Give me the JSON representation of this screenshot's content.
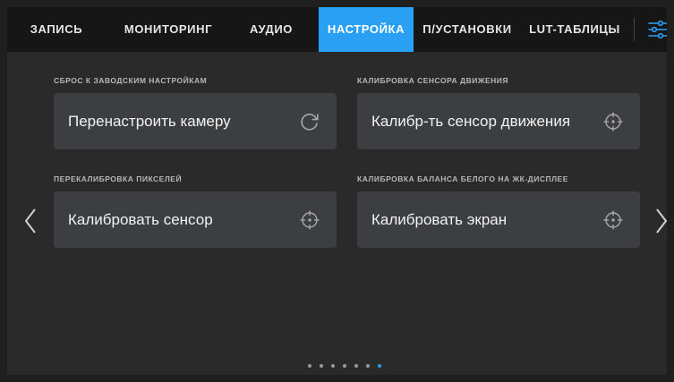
{
  "tabs": [
    {
      "label": "ЗАПИСЬ"
    },
    {
      "label": "МОНИТОРИНГ"
    },
    {
      "label": "АУДИО"
    },
    {
      "label": "НАСТРОЙКА",
      "active": true
    },
    {
      "label": "П/УСТАНОВКИ"
    },
    {
      "label": "LUT-ТАБЛИЦЫ"
    }
  ],
  "settings_icon": "sliders-icon",
  "sections": [
    {
      "label": "СБРОС К ЗАВОДСКИМ НАСТРОЙКАМ",
      "button": "Перенастроить камеру",
      "icon": "refresh-icon"
    },
    {
      "label": "КАЛИБРОВКА СЕНСОРА ДВИЖЕНИЯ",
      "button": "Калибр-ть сенсор движения",
      "icon": "crosshair-icon"
    },
    {
      "label": "ПЕРЕКАЛИБРОВКА ПИКСЕЛЕЙ",
      "button": "Калибровать сенсор",
      "icon": "crosshair-icon"
    },
    {
      "label": "КАЛИБРОВКА БАЛАНСА БЕЛОГО НА ЖК-ДИСПЛЕЕ",
      "button": "Калибровать экран",
      "icon": "crosshair-icon"
    }
  ],
  "navigation": {
    "prev_icon": "chevron-left-icon",
    "next_icon": "chevron-right-icon"
  },
  "pagination": {
    "total": 7,
    "current": 7
  },
  "colors": {
    "accent": "#2aa0f5",
    "background": "#2a2a2a",
    "tabbar": "#161616",
    "button": "#3c3e42"
  }
}
